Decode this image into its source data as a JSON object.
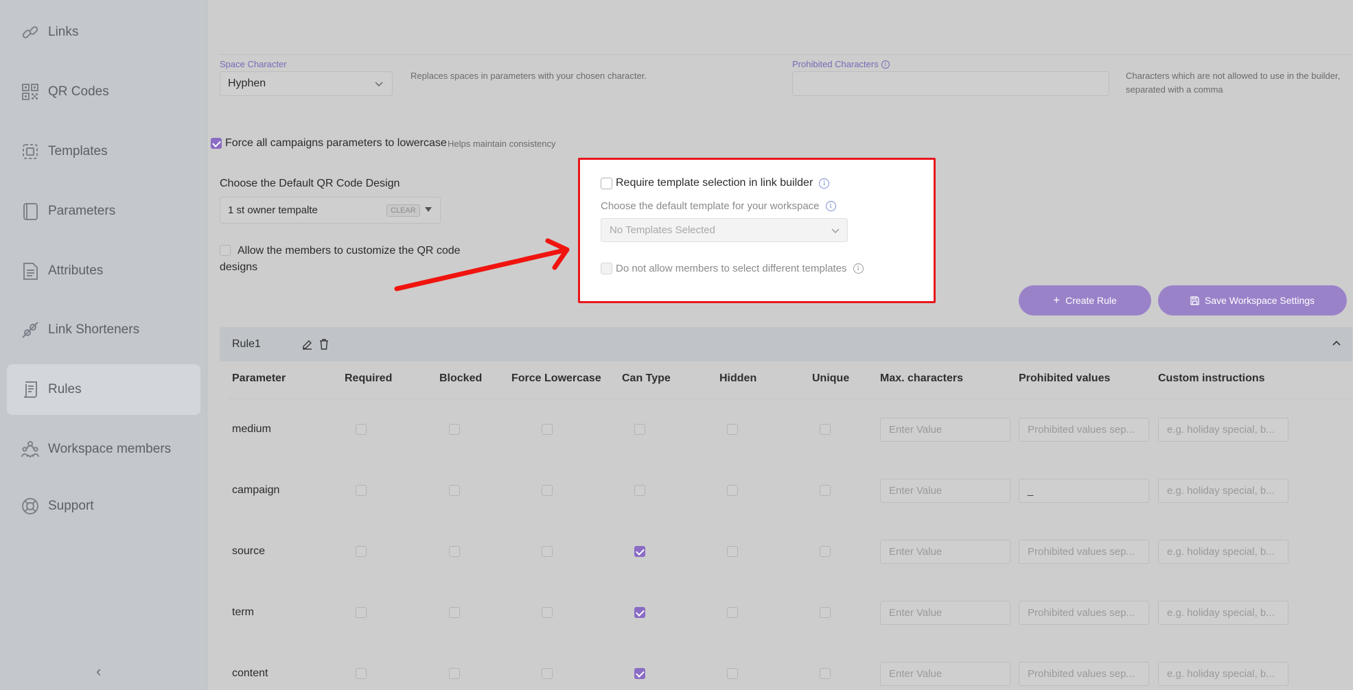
{
  "sidebar": {
    "items": [
      {
        "label": "Links",
        "icon": "link-icon"
      },
      {
        "label": "QR Codes",
        "icon": "qr-code-icon"
      },
      {
        "label": "Templates",
        "icon": "template-icon"
      },
      {
        "label": "Parameters",
        "icon": "parameters-icon"
      },
      {
        "label": "Attributes",
        "icon": "document-icon"
      },
      {
        "label": "Link Shorteners",
        "icon": "link-shortener-icon"
      },
      {
        "label": "Rules",
        "icon": "rules-icon",
        "active": true
      },
      {
        "label": "Workspace members",
        "icon": "team-icon"
      },
      {
        "label": "Support",
        "icon": "lifebuoy-icon"
      }
    ],
    "collapse_label": "‹"
  },
  "settings": {
    "space_character_label": "Space Character",
    "space_character_value": "Hyphen",
    "space_character_hint": "Replaces spaces in parameters with your chosen character.",
    "prohibited_characters_label": "Prohibited Characters",
    "prohibited_characters_value": "",
    "prohibited_characters_hint": "Characters which are not allowed to use in the builder, separated with a comma",
    "force_lowercase_label": "Force all campaigns parameters to lowercase",
    "force_lowercase_hint": "Helps maintain consistency",
    "force_lowercase_checked": true,
    "qr_design_label": "Choose the Default QR Code Design",
    "qr_design_value": "1 st owner tempalte",
    "qr_design_clear": "CLEAR",
    "allow_customize_label": "Allow the members to customize the QR code designs",
    "allow_customize_checked": false
  },
  "template_panel": {
    "require_template_label": "Require template selection in link builder",
    "require_template_checked": false,
    "default_template_label": "Choose the default template for your workspace",
    "default_template_placeholder": "No Templates Selected",
    "disallow_label": "Do not allow members to select different templates",
    "disallow_checked": false
  },
  "buttons": {
    "create_rule": "Create Rule",
    "save_settings": "Save Workspace Settings"
  },
  "rule": {
    "name": "Rule1",
    "columns": [
      "Parameter",
      "Required",
      "Blocked",
      "Force Lowercase",
      "Can Type",
      "Hidden",
      "Unique",
      "Max. characters",
      "Prohibited values",
      "Custom instructions"
    ],
    "rows": [
      {
        "parameter": "medium",
        "required": false,
        "blocked": false,
        "force_lowercase": false,
        "can_type": false,
        "hidden": false,
        "unique": false,
        "max_chars": "",
        "prohibited": "",
        "instructions": ""
      },
      {
        "parameter": "campaign",
        "required": false,
        "blocked": false,
        "force_lowercase": false,
        "can_type": false,
        "hidden": false,
        "unique": false,
        "max_chars": "",
        "prohibited": "_",
        "instructions": ""
      },
      {
        "parameter": "source",
        "required": false,
        "blocked": false,
        "force_lowercase": false,
        "can_type": true,
        "hidden": false,
        "unique": false,
        "max_chars": "",
        "prohibited": "",
        "instructions": ""
      },
      {
        "parameter": "term",
        "required": false,
        "blocked": false,
        "force_lowercase": false,
        "can_type": true,
        "hidden": false,
        "unique": false,
        "max_chars": "",
        "prohibited": "",
        "instructions": ""
      },
      {
        "parameter": "content",
        "required": false,
        "blocked": false,
        "force_lowercase": false,
        "can_type": true,
        "hidden": false,
        "unique": false,
        "max_chars": "",
        "prohibited": "",
        "instructions": ""
      }
    ],
    "placeholders": {
      "max_chars": "Enter Value",
      "prohibited": "Prohibited values sep...",
      "instructions": "e.g. holiday special, b..."
    }
  },
  "colors": {
    "accent": "#8a6cc4",
    "highlight_border": "#e8161b",
    "arrow": "#f0140f"
  }
}
